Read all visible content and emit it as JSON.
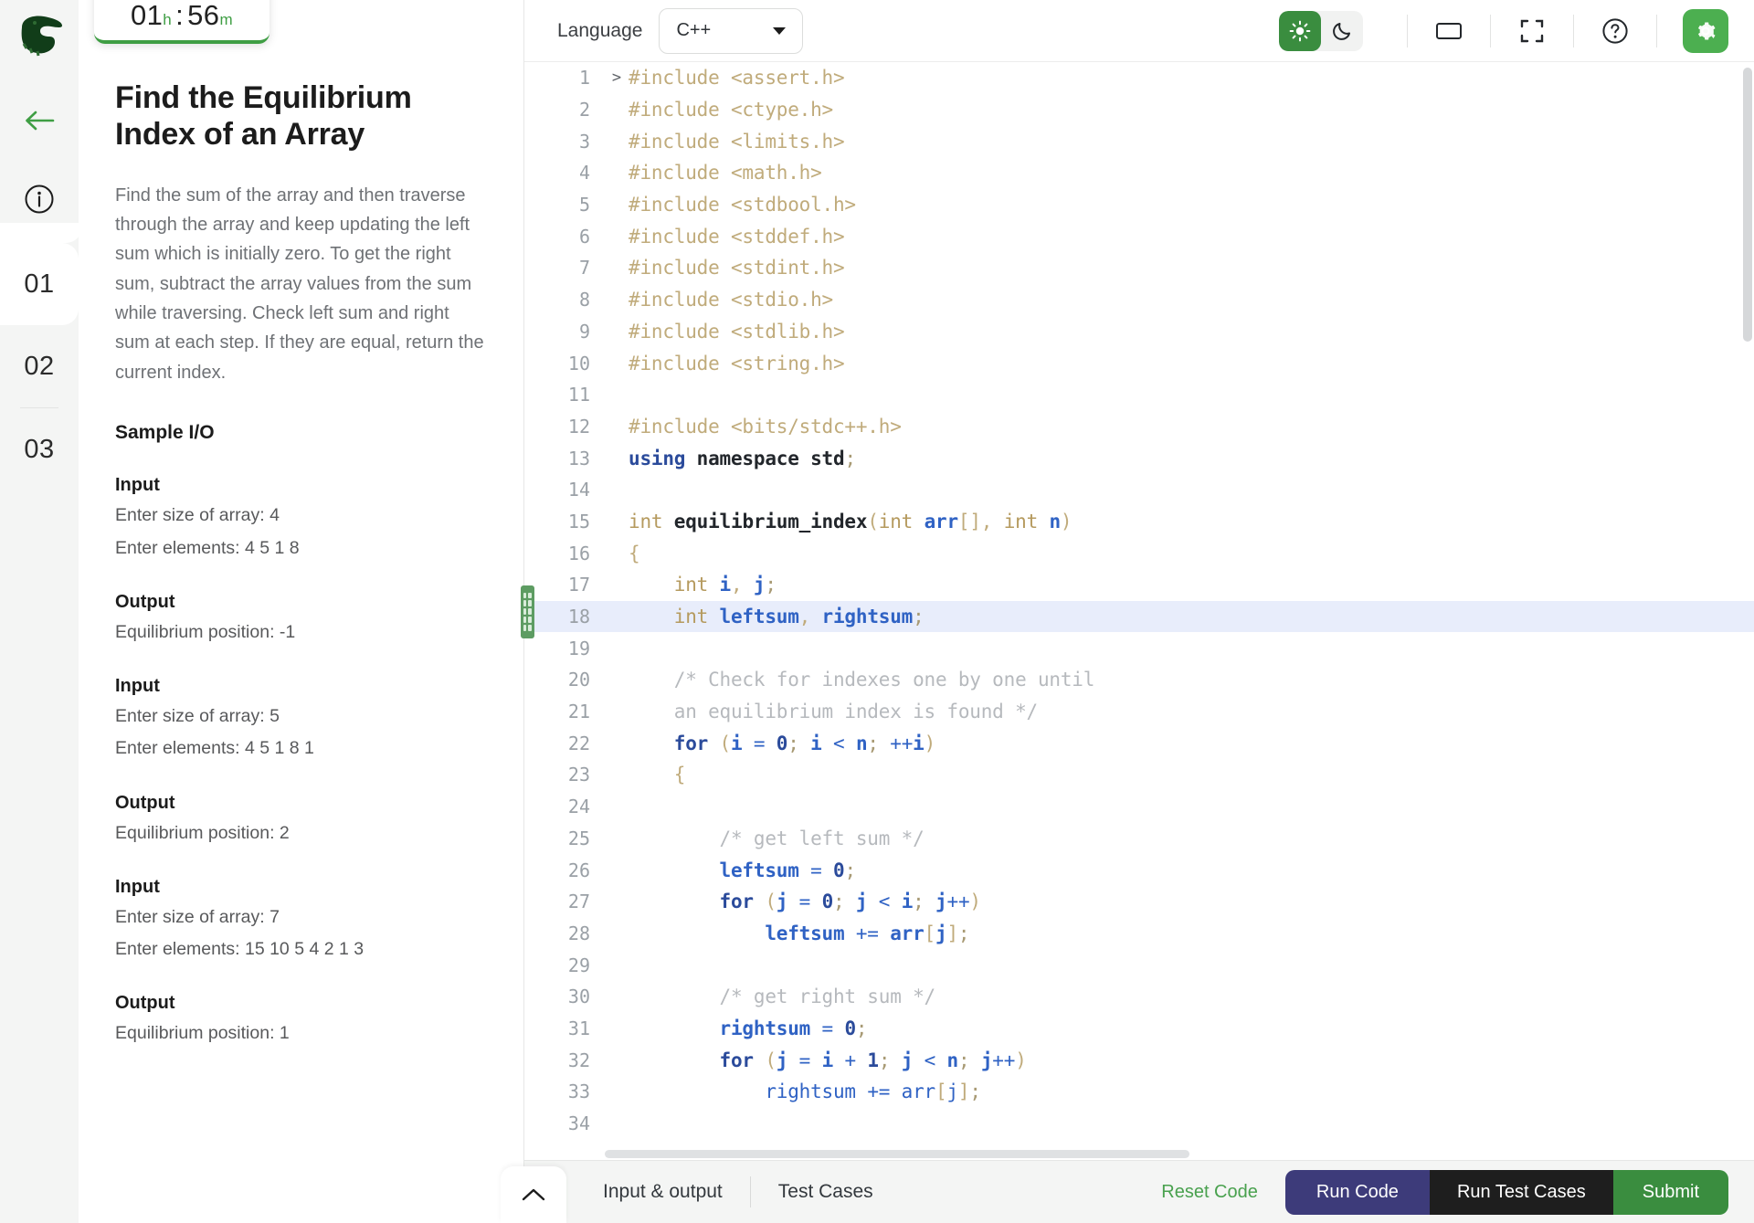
{
  "rail": {
    "logo_icon": "crocodile-logo",
    "back_icon": "arrow-left-icon",
    "info_icon": "info-circle-icon",
    "items": [
      {
        "label": "01",
        "active": true
      },
      {
        "label": "02",
        "active": false
      },
      {
        "label": "03",
        "active": false
      }
    ]
  },
  "timer": {
    "hours": "01",
    "hours_unit": "h",
    "separator": ":",
    "minutes": "56",
    "minutes_unit": "m"
  },
  "problem": {
    "title": "Find the Equilibrium Index of an Array",
    "description": "Find the sum of the array and then traverse through the array and keep updating the left sum which is initially zero. To get the right sum, subtract the array values from the sum while traversing. Check left sum and right sum at each step. If they are equal, return the current index.",
    "sample_heading": "Sample I/O",
    "samples": [
      {
        "input_label": "Input",
        "input_lines": [
          "Enter size of array: 4",
          "Enter elements: 4 5 1 8"
        ],
        "output_label": "Output",
        "output_lines": [
          "Equilibrium position: -1"
        ]
      },
      {
        "input_label": "Input",
        "input_lines": [
          "Enter size of array: 5",
          "Enter elements: 4 5 1 8 1"
        ],
        "output_label": "Output",
        "output_lines": [
          "Equilibrium position: 2"
        ]
      },
      {
        "input_label": "Input",
        "input_lines": [
          "Enter size of array: 7",
          "Enter elements: 15 10 5 4 2 1 3"
        ],
        "output_label": "Output",
        "output_lines": [
          "Equilibrium position: 1"
        ]
      }
    ]
  },
  "toolbar": {
    "language_label": "Language",
    "language_value": "C++",
    "language_options": [
      "C++"
    ],
    "caret_icon": "chevron-down-icon",
    "light_icon": "sun-icon",
    "dark_icon": "moon-icon",
    "layout_icon": "panel-layout-icon",
    "fullscreen_icon": "fullscreen-icon",
    "help_icon": "question-circle-icon",
    "settings_icon": "gear-icon",
    "active_theme": "light"
  },
  "editor": {
    "highlighted_line": 18,
    "fold_marker": ">",
    "lines": [
      {
        "n": "1",
        "tokens": [
          [
            "pp",
            "#include <assert.h>"
          ]
        ]
      },
      {
        "n": "2",
        "tokens": [
          [
            "pp",
            "#include <ctype.h>"
          ]
        ]
      },
      {
        "n": "3",
        "tokens": [
          [
            "pp",
            "#include <limits.h>"
          ]
        ]
      },
      {
        "n": "4",
        "tokens": [
          [
            "pp",
            "#include <math.h>"
          ]
        ]
      },
      {
        "n": "5",
        "tokens": [
          [
            "pp",
            "#include <stdbool.h>"
          ]
        ]
      },
      {
        "n": "6",
        "tokens": [
          [
            "pp",
            "#include <stddef.h>"
          ]
        ]
      },
      {
        "n": "7",
        "tokens": [
          [
            "pp",
            "#include <stdint.h>"
          ]
        ]
      },
      {
        "n": "8",
        "tokens": [
          [
            "pp",
            "#include <stdio.h>"
          ]
        ]
      },
      {
        "n": "9",
        "tokens": [
          [
            "pp",
            "#include <stdlib.h>"
          ]
        ]
      },
      {
        "n": "10",
        "tokens": [
          [
            "pp",
            "#include <string.h>"
          ]
        ]
      },
      {
        "n": "11",
        "tokens": []
      },
      {
        "n": "12",
        "tokens": [
          [
            "pp",
            "#include <bits/stdc++.h>"
          ]
        ]
      },
      {
        "n": "13",
        "tokens": [
          [
            "kw",
            "using"
          ],
          [
            "id",
            " namespace "
          ],
          [
            "id",
            "std"
          ],
          [
            "sc",
            ";"
          ]
        ]
      },
      {
        "n": "14",
        "tokens": []
      },
      {
        "n": "15",
        "tokens": [
          [
            "k",
            "int"
          ],
          [
            "id",
            " equilibrium_index"
          ],
          [
            "pun",
            "("
          ],
          [
            "k",
            "int "
          ],
          [
            "v",
            "arr"
          ],
          [
            "pun",
            "[], "
          ],
          [
            "k",
            "int "
          ],
          [
            "v",
            "n"
          ],
          [
            "pun",
            ")"
          ]
        ]
      },
      {
        "n": "16",
        "tokens": [
          [
            "pun",
            "{"
          ]
        ]
      },
      {
        "n": "17",
        "tokens": [
          [
            "k",
            "    int "
          ],
          [
            "v",
            "i"
          ],
          [
            "pun",
            ", "
          ],
          [
            "v",
            "j"
          ],
          [
            "sc",
            ";"
          ]
        ]
      },
      {
        "n": "18",
        "tokens": [
          [
            "k",
            "    int "
          ],
          [
            "v",
            "leftsum"
          ],
          [
            "pun",
            ", "
          ],
          [
            "v",
            "rightsum"
          ],
          [
            "sc",
            ";"
          ]
        ]
      },
      {
        "n": "19",
        "tokens": []
      },
      {
        "n": "20",
        "tokens": [
          [
            "cm",
            "    /* Check for indexes one by one until"
          ]
        ]
      },
      {
        "n": "21",
        "tokens": [
          [
            "cm",
            "    an equilibrium index is found */"
          ]
        ]
      },
      {
        "n": "22",
        "tokens": [
          [
            "kw",
            "    for"
          ],
          [
            "pun",
            " ("
          ],
          [
            "v",
            "i"
          ],
          [
            "op",
            " = "
          ],
          [
            "num",
            "0"
          ],
          [
            "sc",
            "; "
          ],
          [
            "v",
            "i"
          ],
          [
            "op",
            " < "
          ],
          [
            "v",
            "n"
          ],
          [
            "sc",
            "; "
          ],
          [
            "op",
            "++"
          ],
          [
            "v",
            "i"
          ],
          [
            "pun",
            ")"
          ]
        ]
      },
      {
        "n": "23",
        "tokens": [
          [
            "pun",
            "    {"
          ]
        ]
      },
      {
        "n": "24",
        "tokens": []
      },
      {
        "n": "25",
        "tokens": [
          [
            "cm",
            "        /* get left sum */"
          ]
        ]
      },
      {
        "n": "26",
        "tokens": [
          [
            "v",
            "        leftsum"
          ],
          [
            "op",
            " = "
          ],
          [
            "num",
            "0"
          ],
          [
            "sc",
            ";"
          ]
        ]
      },
      {
        "n": "27",
        "tokens": [
          [
            "kw",
            "        for"
          ],
          [
            "pun",
            " ("
          ],
          [
            "v",
            "j"
          ],
          [
            "op",
            " = "
          ],
          [
            "num",
            "0"
          ],
          [
            "sc",
            "; "
          ],
          [
            "v",
            "j"
          ],
          [
            "op",
            " < "
          ],
          [
            "v",
            "i"
          ],
          [
            "sc",
            "; "
          ],
          [
            "v",
            "j"
          ],
          [
            "op",
            "++"
          ],
          [
            "pun",
            ")"
          ]
        ]
      },
      {
        "n": "28",
        "tokens": [
          [
            "v",
            "            leftsum"
          ],
          [
            "op",
            " += "
          ],
          [
            "v",
            "arr"
          ],
          [
            "pun",
            "["
          ],
          [
            "v",
            "j"
          ],
          [
            "pun",
            "]"
          ],
          [
            "sc",
            ";"
          ]
        ]
      },
      {
        "n": "29",
        "tokens": []
      },
      {
        "n": "30",
        "tokens": [
          [
            "cm",
            "        /* get right sum */"
          ]
        ]
      },
      {
        "n": "31",
        "tokens": [
          [
            "v",
            "        rightsum"
          ],
          [
            "op",
            " = "
          ],
          [
            "num",
            "0"
          ],
          [
            "sc",
            ";"
          ]
        ]
      },
      {
        "n": "32",
        "tokens": [
          [
            "kw",
            "        for"
          ],
          [
            "pun",
            " ("
          ],
          [
            "v",
            "j"
          ],
          [
            "op",
            " = "
          ],
          [
            "v",
            "i"
          ],
          [
            "op",
            " + "
          ],
          [
            "num",
            "1"
          ],
          [
            "sc",
            "; "
          ],
          [
            "v",
            "j"
          ],
          [
            "op",
            " < "
          ],
          [
            "v",
            "n"
          ],
          [
            "sc",
            "; "
          ],
          [
            "v",
            "j"
          ],
          [
            "op",
            "++"
          ],
          [
            "pun",
            ")"
          ]
        ]
      },
      {
        "n": "33",
        "tokens": [
          [
            "vm",
            "            rightsum"
          ],
          [
            "op",
            " += "
          ],
          [
            "vm",
            "arr"
          ],
          [
            "pun",
            "["
          ],
          [
            "vm",
            "j"
          ],
          [
            "pun",
            "]"
          ],
          [
            "sc",
            ";"
          ]
        ]
      },
      {
        "n": "34",
        "tokens": []
      }
    ]
  },
  "bottombar": {
    "collapse_icon": "chevron-up-icon",
    "tabs": [
      {
        "label": "Input & output"
      },
      {
        "label": "Test Cases"
      }
    ],
    "reset_label": "Reset Code",
    "run_label": "Run Code",
    "run_tests_label": "Run Test Cases",
    "submit_label": "Submit"
  },
  "colors": {
    "brand_green": "#3a8d3f",
    "accent_green": "#4caf50",
    "run_purple": "#3d3b7a",
    "run_tests_black": "#1e1e1e",
    "highlight_line": "#e8edfb"
  }
}
